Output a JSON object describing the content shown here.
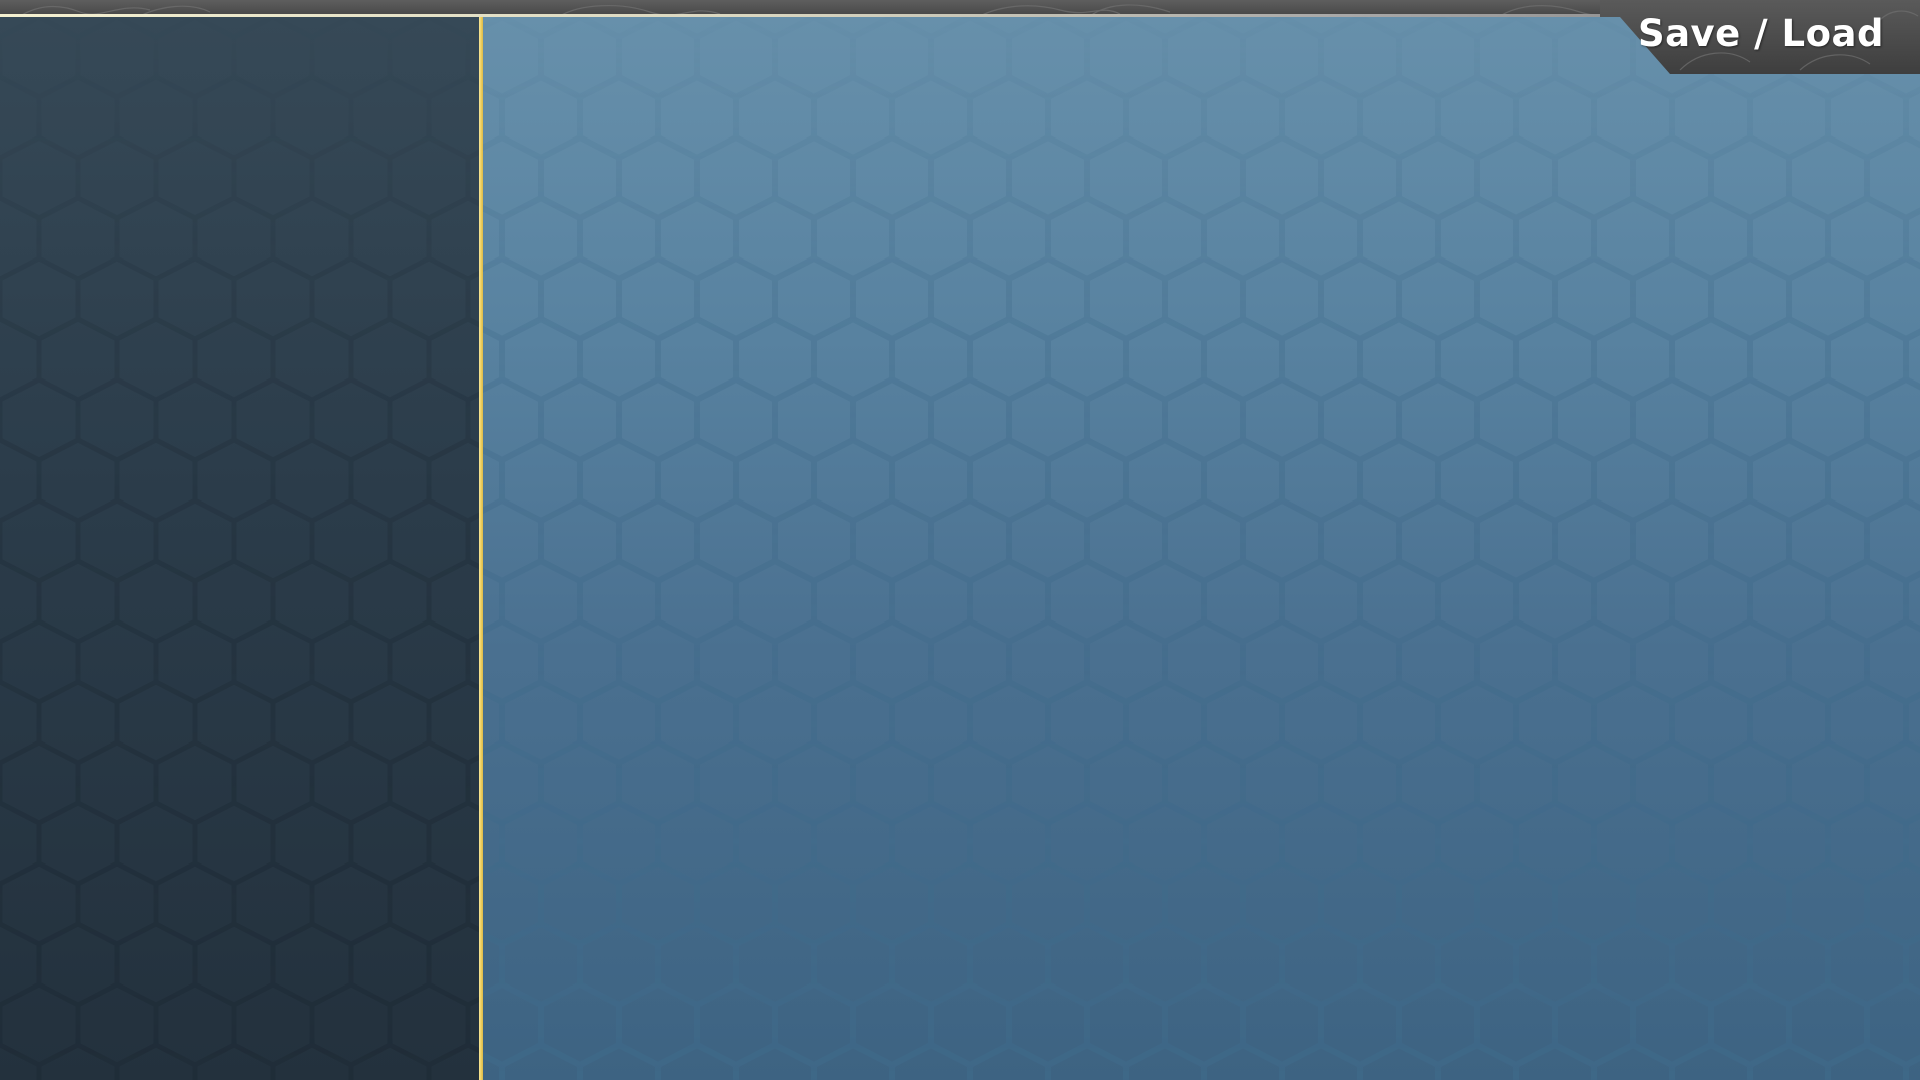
{
  "screen": {
    "title": "Save / Load"
  },
  "colors": {
    "left_panel_top": "#364957",
    "left_panel_bottom": "#23313d",
    "main_panel_top": "#6790ab",
    "main_panel_bottom": "#3d6382",
    "divider": "#f0d060",
    "top_bar": "#555555",
    "title_tab": "#4a4a4a",
    "title_text": "#ffffff"
  }
}
